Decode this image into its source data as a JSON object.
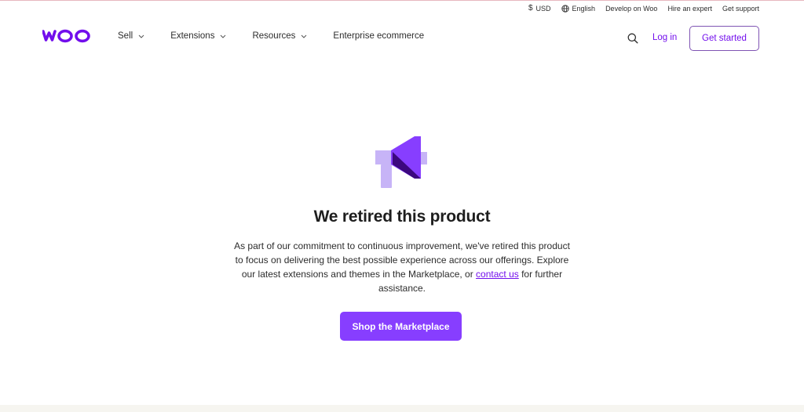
{
  "utility": {
    "currency_symbol": "$",
    "currency": "USD",
    "language": "English",
    "develop": "Develop on Woo",
    "hire": "Hire an expert",
    "support": "Get support"
  },
  "header": {
    "nav": {
      "sell": "Sell",
      "extensions": "Extensions",
      "resources": "Resources",
      "enterprise": "Enterprise ecommerce"
    },
    "login": "Log in",
    "get_started": "Get started"
  },
  "main": {
    "title": "We retired this product",
    "body_before": "As part of our commitment to continuous improvement, we've retired this product to focus on delivering the best possible experience across our offerings. Explore our latest extensions and themes in the Marketplace, or ",
    "contact_link": "contact us",
    "body_after": " for further assistance.",
    "cta": "Shop the Marketplace"
  },
  "icons": {
    "logo": "woo-logo",
    "search": "search-icon",
    "globe": "globe-icon",
    "chevron": "chevron-down-icon",
    "hero": "megaphone-icon"
  },
  "colors": {
    "brand": "#720eec",
    "button": "#873eff",
    "megaphone_light": "#c7b4f7",
    "megaphone_dark": "#3c087e"
  }
}
